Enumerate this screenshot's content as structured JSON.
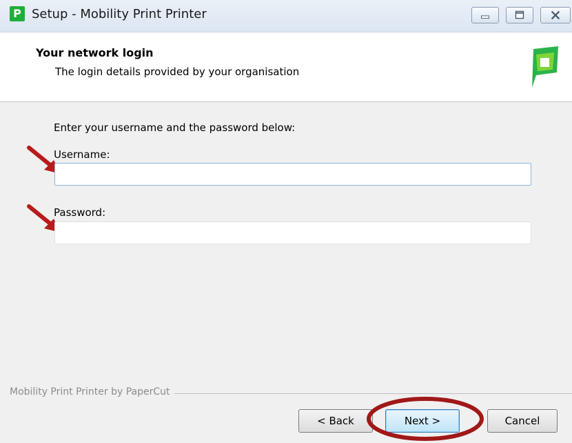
{
  "window": {
    "title": "Setup - Mobility Print Printer",
    "icon": "papercut-p-icon",
    "controls": [
      "minimize",
      "maximize",
      "close"
    ]
  },
  "header": {
    "title": "Your network login",
    "subtitle": "The login details provided by your organisation",
    "logo": "papercut-logo"
  },
  "form": {
    "instruction": "Enter your username and the password below:",
    "username_label": "Username:",
    "username_value": "",
    "password_label": "Password:",
    "password_value": ""
  },
  "footer": {
    "brand": "Mobility Print Printer by PaperCut",
    "back_label": "< Back",
    "next_label": "Next >",
    "cancel_label": "Cancel"
  },
  "annotations": {
    "arrow_color": "#b71c1c",
    "ring_color": "#a01818"
  }
}
